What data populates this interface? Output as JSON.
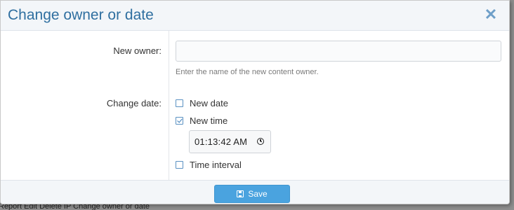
{
  "dialog": {
    "title": "Change owner or date",
    "close_icon": "close-icon",
    "owner": {
      "label": "New owner:",
      "value": "",
      "placeholder": "",
      "hint": "Enter the name of the new content owner."
    },
    "change_date": {
      "label": "Change date:",
      "options": [
        {
          "label": "New date",
          "checked": false
        },
        {
          "label": "New time",
          "checked": true
        },
        {
          "label": "Time interval",
          "checked": false
        }
      ],
      "time_value": "01:13:42 AM",
      "time_icon": "clock-icon"
    },
    "footer": {
      "save_label": "Save",
      "save_icon": "floppy-disk-icon",
      "save_color": "#4aa3df"
    }
  },
  "backdrop": {
    "text": "Report    Edit    Delete    IP    Change owner or date"
  },
  "colors": {
    "title": "#2f6fa0",
    "accent": "#4aa3df"
  }
}
